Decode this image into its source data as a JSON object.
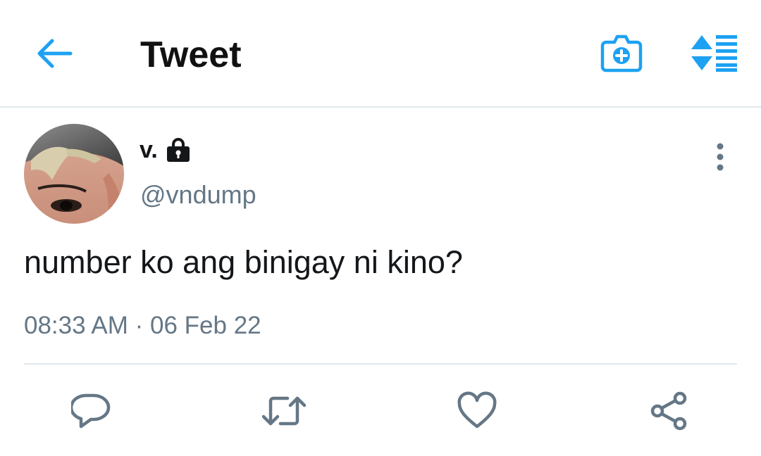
{
  "appbar": {
    "title": "Tweet",
    "back_icon": "arrow-left-icon",
    "camera_icon": "camera-plus-icon",
    "sort_icon": "sort-list-icon"
  },
  "tweet": {
    "display_name": "v.",
    "protected_icon": "lock-icon",
    "handle": "@vndump",
    "text": "number ko ang binigay ni kino?",
    "time": "08:33 AM",
    "separator": "·",
    "date": "06 Feb 22",
    "more_icon": "more-vertical-icon"
  },
  "actions": {
    "reply_icon": "reply-icon",
    "retweet_icon": "retweet-icon",
    "like_icon": "heart-icon",
    "share_icon": "share-icon"
  },
  "colors": {
    "accent": "#1da1f2",
    "icon_gray": "#657786",
    "text_primary": "#14171a",
    "divider": "#e1e8ed"
  }
}
